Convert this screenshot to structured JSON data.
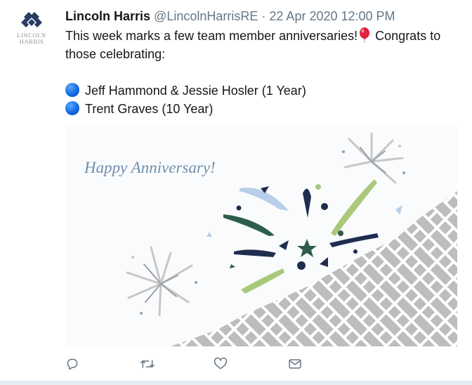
{
  "author": {
    "name": "Lincoln Harris",
    "handle": "@LincolnHarrisRE",
    "separator": "·",
    "timestamp": "22 Apr 2020 12:00 PM",
    "avatar_logo_line1": "LINCOLN",
    "avatar_logo_line2": "HARRIS"
  },
  "tweet": {
    "line1": "This week marks a few team member anniversaries!",
    "line1_tail": "Congrats to",
    "line2": "those celebrating:",
    "bullets": [
      "Jeff Hammond & Jessie Hosler (1 Year)",
      "Trent Graves (10 Year)"
    ]
  },
  "media": {
    "caption": "Happy Anniversary!"
  },
  "icons": {
    "reply": "reply-icon",
    "retweet": "retweet-icon",
    "like": "like-icon",
    "message": "message-icon",
    "balloon": "balloon-emoji",
    "bullet": "blue-circle-emoji"
  },
  "colors": {
    "link_grey": "#657786",
    "navy": "#1e2d4f",
    "dark_green": "#2d5e4a",
    "light_green": "#a9c97a",
    "light_blue": "#b7cfe8",
    "grey_pattern": "#bdbdbd",
    "caption_blue": "#6f8fae"
  }
}
